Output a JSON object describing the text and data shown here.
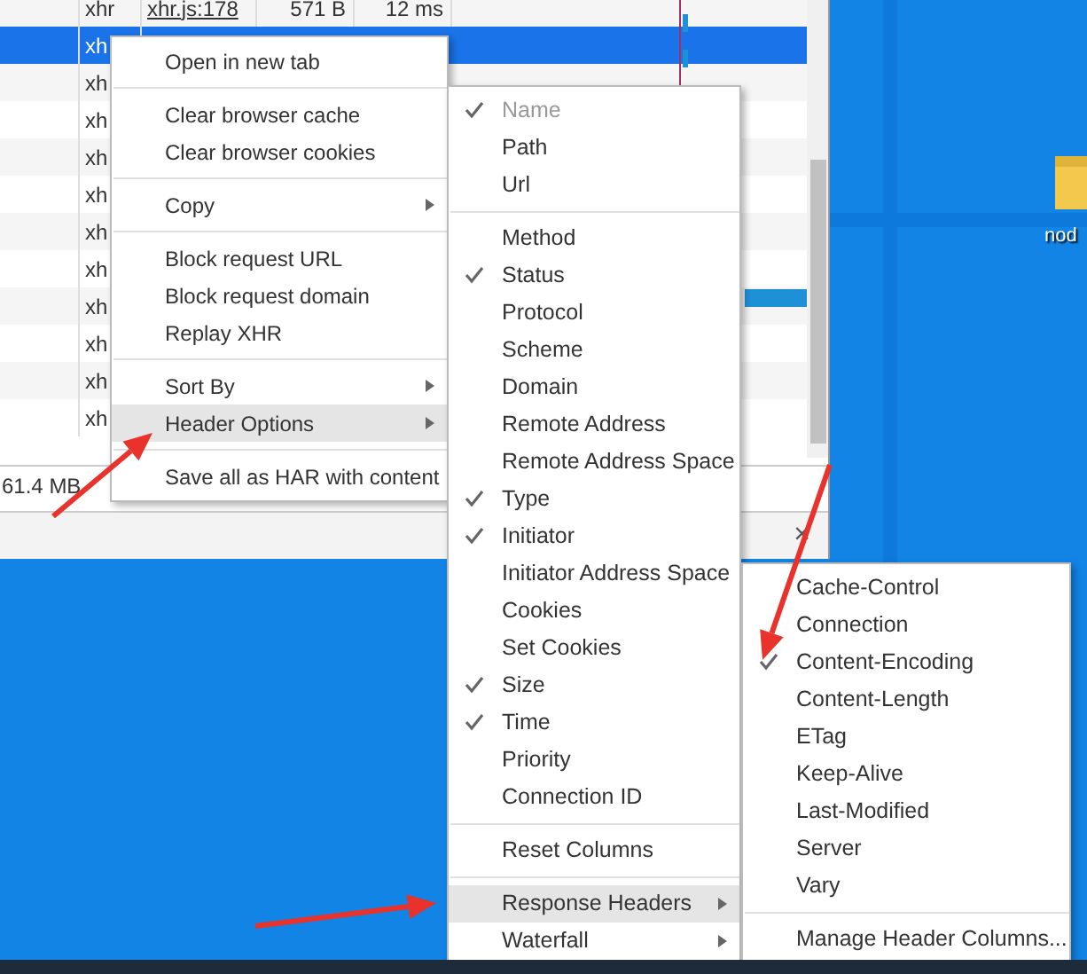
{
  "desktop": {
    "icon_label": "nod"
  },
  "network_table": {
    "rows": [
      {
        "type": "xhr",
        "initiator": "xhr.js:178",
        "size": "571 B",
        "time": "12 ms",
        "selected": false
      },
      {
        "type": "xh",
        "selected": true
      },
      {
        "type": "xh",
        "selected": false
      },
      {
        "type": "xh",
        "selected": false
      },
      {
        "type": "xh",
        "selected": false
      },
      {
        "type": "xh",
        "selected": false
      },
      {
        "type": "xh",
        "selected": false
      },
      {
        "type": "xh",
        "selected": false
      },
      {
        "type": "xh",
        "selected": false
      },
      {
        "type": "xh",
        "selected": false
      },
      {
        "type": "xh",
        "selected": false
      },
      {
        "type": "xh",
        "selected": false
      }
    ],
    "status_text": "61.4 MB",
    "drawer_close": "×"
  },
  "context_menu": {
    "items": [
      {
        "kind": "item",
        "label": "Open in new tab",
        "submenu": false,
        "highlighted": false
      },
      {
        "kind": "separator"
      },
      {
        "kind": "item",
        "label": "Clear browser cache",
        "submenu": false,
        "highlighted": false
      },
      {
        "kind": "item",
        "label": "Clear browser cookies",
        "submenu": false,
        "highlighted": false
      },
      {
        "kind": "separator"
      },
      {
        "kind": "item",
        "label": "Copy",
        "submenu": true,
        "highlighted": false
      },
      {
        "kind": "separator"
      },
      {
        "kind": "item",
        "label": "Block request URL",
        "submenu": false,
        "highlighted": false
      },
      {
        "kind": "item",
        "label": "Block request domain",
        "submenu": false,
        "highlighted": false
      },
      {
        "kind": "item",
        "label": "Replay XHR",
        "submenu": false,
        "highlighted": false
      },
      {
        "kind": "separator"
      },
      {
        "kind": "item",
        "label": "Sort By",
        "submenu": true,
        "highlighted": false
      },
      {
        "kind": "item",
        "label": "Header Options",
        "submenu": true,
        "highlighted": true
      },
      {
        "kind": "separator"
      },
      {
        "kind": "item",
        "label": "Save all as HAR with content",
        "submenu": false,
        "highlighted": false
      }
    ]
  },
  "header_options_menu": {
    "items": [
      {
        "kind": "item",
        "label": "Name",
        "checked": true,
        "disabled": true
      },
      {
        "kind": "item",
        "label": "Path",
        "checked": false,
        "disabled": false
      },
      {
        "kind": "item",
        "label": "Url",
        "checked": false,
        "disabled": false
      },
      {
        "kind": "separator"
      },
      {
        "kind": "item",
        "label": "Method",
        "checked": false,
        "disabled": false
      },
      {
        "kind": "item",
        "label": "Status",
        "checked": true,
        "disabled": false
      },
      {
        "kind": "item",
        "label": "Protocol",
        "checked": false,
        "disabled": false
      },
      {
        "kind": "item",
        "label": "Scheme",
        "checked": false,
        "disabled": false
      },
      {
        "kind": "item",
        "label": "Domain",
        "checked": false,
        "disabled": false
      },
      {
        "kind": "item",
        "label": "Remote Address",
        "checked": false,
        "disabled": false
      },
      {
        "kind": "item",
        "label": "Remote Address Space",
        "checked": false,
        "disabled": false
      },
      {
        "kind": "item",
        "label": "Type",
        "checked": true,
        "disabled": false
      },
      {
        "kind": "item",
        "label": "Initiator",
        "checked": true,
        "disabled": false
      },
      {
        "kind": "item",
        "label": "Initiator Address Space",
        "checked": false,
        "disabled": false
      },
      {
        "kind": "item",
        "label": "Cookies",
        "checked": false,
        "disabled": false
      },
      {
        "kind": "item",
        "label": "Set Cookies",
        "checked": false,
        "disabled": false
      },
      {
        "kind": "item",
        "label": "Size",
        "checked": true,
        "disabled": false
      },
      {
        "kind": "item",
        "label": "Time",
        "checked": true,
        "disabled": false
      },
      {
        "kind": "item",
        "label": "Priority",
        "checked": false,
        "disabled": false
      },
      {
        "kind": "item",
        "label": "Connection ID",
        "checked": false,
        "disabled": false
      },
      {
        "kind": "separator"
      },
      {
        "kind": "item",
        "label": "Reset Columns",
        "checked": false,
        "disabled": false
      },
      {
        "kind": "separator"
      },
      {
        "kind": "submenu",
        "label": "Response Headers",
        "highlighted": true
      },
      {
        "kind": "submenu",
        "label": "Waterfall",
        "highlighted": false
      }
    ]
  },
  "response_headers_menu": {
    "items": [
      {
        "kind": "item",
        "label": "Cache-Control",
        "checked": false
      },
      {
        "kind": "item",
        "label": "Connection",
        "checked": false
      },
      {
        "kind": "item",
        "label": "Content-Encoding",
        "checked": true
      },
      {
        "kind": "item",
        "label": "Content-Length",
        "checked": false
      },
      {
        "kind": "item",
        "label": "ETag",
        "checked": false
      },
      {
        "kind": "item",
        "label": "Keep-Alive",
        "checked": false
      },
      {
        "kind": "item",
        "label": "Last-Modified",
        "checked": false
      },
      {
        "kind": "item",
        "label": "Server",
        "checked": false
      },
      {
        "kind": "item",
        "label": "Vary",
        "checked": false
      },
      {
        "kind": "separator"
      },
      {
        "kind": "item",
        "label": "Manage Header Columns...",
        "checked": false
      }
    ]
  }
}
